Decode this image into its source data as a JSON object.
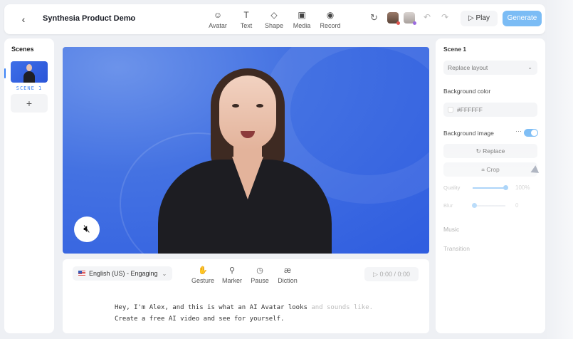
{
  "header": {
    "back_icon": "back-arrow-icon",
    "project_title": "Synthesia Product Demo",
    "title_chevron": "chevron-down-icon",
    "tools": [
      {
        "label": "Avatar",
        "icon": "avatar-icon",
        "glyph": "☺"
      },
      {
        "label": "Text",
        "icon": "text-icon",
        "glyph": "T"
      },
      {
        "label": "Shape",
        "icon": "shape-icon",
        "glyph": "◇"
      },
      {
        "label": "Media",
        "icon": "media-icon",
        "glyph": "▣"
      },
      {
        "label": "Record",
        "icon": "record-icon",
        "glyph": "◉"
      }
    ],
    "play_label": "Play",
    "generate_label": "Generate"
  },
  "scenes": {
    "title": "Scenes",
    "items": [
      {
        "label": "SCENE 1"
      }
    ],
    "add_glyph": "+"
  },
  "bottom": {
    "language_label": "English (US) - Engaging",
    "tools": [
      {
        "label": "Gesture",
        "icon": "gesture-icon",
        "glyph": "✋"
      },
      {
        "label": "Marker",
        "icon": "marker-icon",
        "glyph": "⚲"
      },
      {
        "label": "Pause",
        "icon": "pause-icon",
        "glyph": "◷"
      },
      {
        "label": "Diction",
        "icon": "diction-icon",
        "glyph": "æ"
      }
    ],
    "time": "0:00 / 0:00",
    "script_line1_a": "Hey, I'm Alex, and this is what an AI Avatar looks ",
    "script_line1_b": "and sounds like.",
    "script_line2": "Create a free AI video and see for yourself."
  },
  "properties": {
    "scene_title": "Scene 1",
    "layout_placeholder": "Replace layout",
    "bg_color_label": "Background color",
    "bg_color_value": "#FFFFFF",
    "bg_image_label": "Background image",
    "replace_label": "Replace",
    "crop_label": "Crop",
    "quality_label": "Quality",
    "quality_value": "100%",
    "quality_level": 1.0,
    "blur_label": "Blur",
    "blur_value": "0",
    "blur_level": 0,
    "music_label": "Music",
    "transition_label": "Transition",
    "bg_image_enabled": true
  },
  "colors": {
    "accent": "#3b82f6",
    "generate_button": "#7bbcf5",
    "canvas_background": "#3f6ce4"
  }
}
